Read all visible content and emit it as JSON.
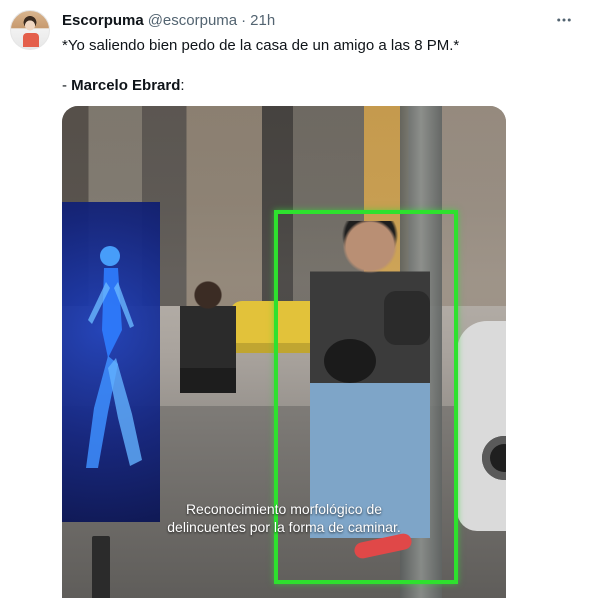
{
  "tweet": {
    "display_name": "Escorpuma",
    "handle": "@escorpuma",
    "dot": "·",
    "time": "21h",
    "line1": "*Yo saliendo bien pedo de la casa de un amigo a las 8 PM.*",
    "line2_prefix": "- ",
    "line2_bold": "Marcelo Ebrard",
    "line2_suffix": ":"
  },
  "media": {
    "caption_line1": "Reconocimiento morfológico de",
    "caption_line2": "delincuentes por la forma de caminar."
  },
  "icons": {
    "more": "more-horizontal-icon"
  },
  "colors": {
    "text": "#0f1419",
    "secondary": "#536471",
    "highlight_box": "#2ee12e"
  }
}
